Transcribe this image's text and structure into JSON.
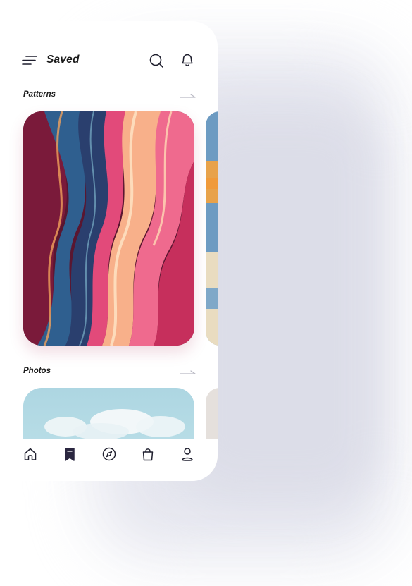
{
  "header": {
    "title": "Saved",
    "icons": [
      "menu-icon",
      "search-icon",
      "bell-icon"
    ]
  },
  "sections": [
    {
      "label": "Patterns",
      "arrow_icon": "arrow-right-icon"
    },
    {
      "label": "Photos",
      "arrow_icon": "arrow-right-icon"
    }
  ],
  "bottom_nav": {
    "items": [
      "home-icon",
      "bookmark-icon",
      "compass-icon",
      "bag-icon",
      "profile-icon"
    ],
    "active": "bookmark-icon"
  },
  "colors": {
    "text": "#1a1a1a",
    "active_nav": "#2b2740",
    "icon": "#1f1f2e",
    "arrow": "#b9b9c3"
  }
}
